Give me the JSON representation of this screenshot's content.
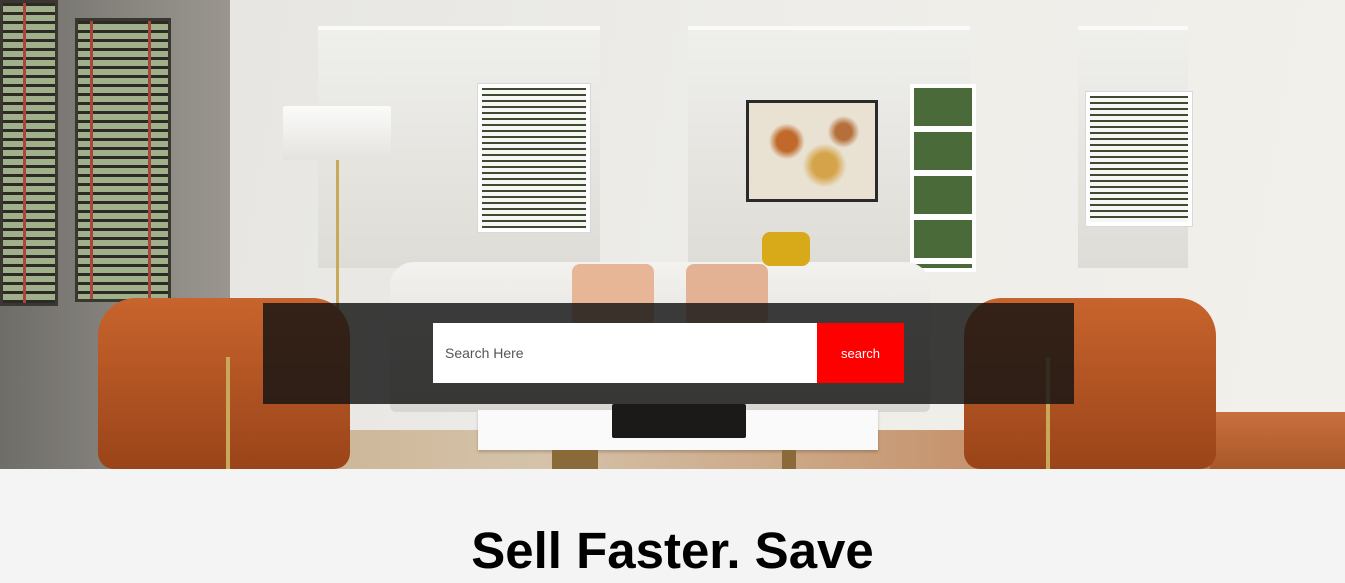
{
  "hero": {
    "search": {
      "placeholder": "Search Here",
      "button_label": "search"
    }
  },
  "main": {
    "headline": "Sell Faster. Save"
  },
  "colors": {
    "search_button": "#ff0000",
    "overlay": "#141414",
    "page_background": "#f4f4f4"
  }
}
